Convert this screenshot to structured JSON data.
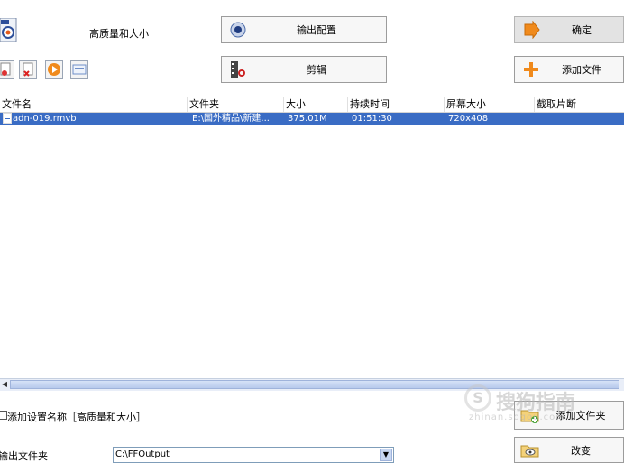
{
  "toolbar": {
    "profile_label": "高质量和大小",
    "output_config": "输出配置",
    "confirm": "确定",
    "cut": "剪辑",
    "add_file": "添加文件"
  },
  "table": {
    "headers": [
      "文件名",
      "文件夹",
      "大小",
      "持续时间",
      "屏幕大小",
      "截取片断"
    ],
    "rows": [
      [
        "adn-019.rmvb",
        "E:\\国外精品\\新建...",
        "375.01M",
        "01:51:30",
        "720x408",
        ""
      ]
    ]
  },
  "bottom": {
    "add_setting_name": "添加设置名称［高质量和大小］",
    "output_folder_label": "输出文件夹",
    "output_folder_value": "C:\\FFOutput",
    "add_folder": "添加文件夹",
    "change": "改变"
  },
  "watermark": {
    "brand": "搜狗指南",
    "url": "zhinan.sogou.com"
  },
  "colors": {
    "selection": "#3a6cc4",
    "orange": "#f08a1c"
  }
}
